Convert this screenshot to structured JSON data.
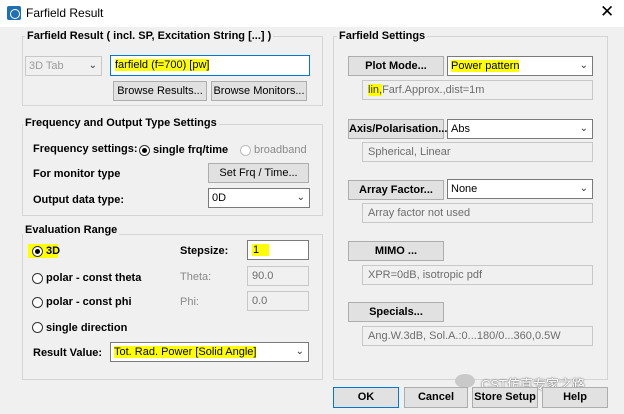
{
  "window": {
    "title": "Farfield Result",
    "close_glyph": "✕"
  },
  "farfield_result": {
    "group_title": "Farfield Result ( incl. SP, Excitation String [...] )",
    "tab_select": "3D Tab",
    "name_value": "farfield (f=700) [pw]",
    "browse_results": "Browse Results...",
    "browse_monitors": "Browse Monitors..."
  },
  "frequency": {
    "group_title": "Frequency and Output Type Settings",
    "settings_label": "Frequency settings:",
    "single_label": "single frq/time",
    "broadband_label": "broadband",
    "monitor_label": "For monitor type",
    "set_frq_button": "Set Frq / Time...",
    "output_label": "Output data type:",
    "output_value": "0D"
  },
  "evaluation": {
    "group_title": "Evaluation Range",
    "opt_3d": "3D",
    "opt_polar_theta": "polar - const theta",
    "opt_polar_phi": "polar - const phi",
    "opt_single": "single direction",
    "stepsize_label": "Stepsize:",
    "stepsize_value": "1",
    "theta_label": "Theta:",
    "theta_value": "90.0",
    "phi_label": "Phi:",
    "phi_value": "0.0",
    "result_label": "Result Value:",
    "result_value": "Tot. Rad. Power [Solid Angle]"
  },
  "farfield_settings": {
    "group_title": "Farfield Settings",
    "plot_mode_button": "Plot Mode...",
    "plot_mode_value": "Power pattern",
    "plot_mode_info_hl": "lin,",
    "plot_mode_info_rest": "Farf.Approx.,dist=1m",
    "axis_button": "Axis/Polarisation...",
    "axis_value": "Abs",
    "axis_info": "Spherical, Linear",
    "array_button": "Array Factor...",
    "array_value": "None",
    "array_info": "Array factor not used",
    "mimo_button": "MIMO ...",
    "mimo_info": "XPR=0dB, isotropic pdf",
    "specials_button": "Specials...",
    "specials_info": "Ang.W.3dB, Sol.A.:0...180/0...360,0.5W"
  },
  "footer": {
    "ok": "OK",
    "cancel": "Cancel",
    "store_setup": "Store Setup",
    "help": "Help",
    "watermark": "CST仿真专家之路"
  },
  "colors": {
    "highlight": "#ffff00",
    "background": "#f0f0f0"
  }
}
